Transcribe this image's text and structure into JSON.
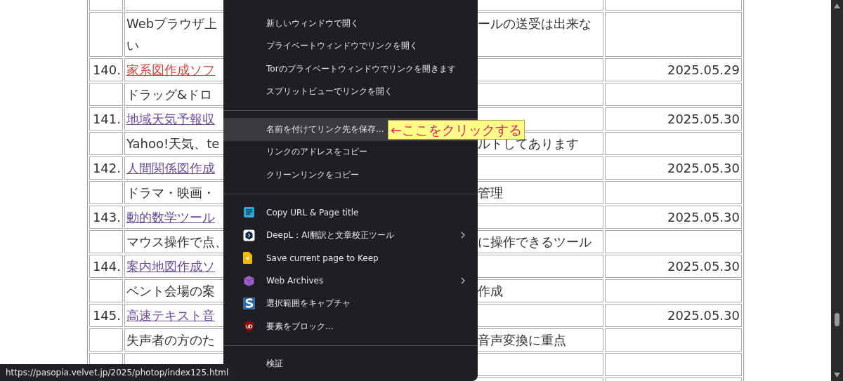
{
  "table": {
    "rows": [
      {
        "kind": "entry",
        "number": "",
        "title": "",
        "date": ""
      },
      {
        "kind": "desc",
        "left": "Webブラウザ上",
        "right": "ールの送受は出来な",
        "continuation": "い"
      },
      {
        "kind": "entry",
        "number": "140.",
        "title": "家系図作成ソフ",
        "visited": false,
        "date": "2025.05.29"
      },
      {
        "kind": "desc",
        "left": "ドラッグ&ドロ",
        "right": ""
      },
      {
        "kind": "entry",
        "number": "141.",
        "title": "地域天気予報収",
        "visited": true,
        "date": "2025.05.30"
      },
      {
        "kind": "desc",
        "left": "Yahoo!天気、te",
        "right": "ルトしてあります"
      },
      {
        "kind": "entry",
        "number": "142.",
        "title": "人間関係図作成",
        "visited": true,
        "date": "2025.05.30"
      },
      {
        "kind": "desc",
        "left": "ドラマ・映画・",
        "right": "管理"
      },
      {
        "kind": "entry",
        "number": "143.",
        "title": "動的数学ツール",
        "visited": true,
        "date": "2025.05.30"
      },
      {
        "kind": "desc",
        "left": "マウス操作で点、",
        "right": "に操作できるツール"
      },
      {
        "kind": "entry",
        "number": "144.",
        "title": "案内地図作成ソ",
        "visited": true,
        "date": "2025.05.30"
      },
      {
        "kind": "desc",
        "left": "ベント会場の案",
        "right": "作成"
      },
      {
        "kind": "entry",
        "number": "145.",
        "title": "高速テキスト音",
        "visited": true,
        "date": "2025.05.30"
      },
      {
        "kind": "desc",
        "left": "失声者の方のた",
        "right": "音声変換に重点"
      },
      {
        "kind": "entry",
        "number": "",
        "title": "",
        "date": ""
      },
      {
        "kind": "desc",
        "left": "",
        "right": ""
      }
    ]
  },
  "context_menu": {
    "groups": [
      [
        {
          "kind": "plain",
          "label": "新しいウィンドウで開く",
          "highlighted": false,
          "submenu": false
        },
        {
          "kind": "plain",
          "label": "プライベートウィンドウでリンクを開く",
          "highlighted": false,
          "submenu": false
        },
        {
          "kind": "plain",
          "label": "Torのプライベートウィンドウでリンクを開きます",
          "highlighted": false,
          "submenu": false
        },
        {
          "kind": "plain",
          "label": "スプリットビューでリンクを開く",
          "highlighted": false,
          "submenu": false
        }
      ],
      [
        {
          "kind": "plain",
          "label": "名前を付けてリンク先を保存...",
          "highlighted": true,
          "submenu": false
        },
        {
          "kind": "plain",
          "label": "リンクのアドレスをコピー",
          "highlighted": false,
          "submenu": false
        },
        {
          "kind": "plain",
          "label": "クリーンリンクをコピー",
          "highlighted": false,
          "submenu": false
        }
      ],
      [
        {
          "kind": "extension",
          "label": "Copy URL & Page title",
          "highlighted": false,
          "submenu": false
        },
        {
          "kind": "extension",
          "label": "DeepL：AI翻訳と文章校正ツール",
          "highlighted": false,
          "submenu": true
        },
        {
          "kind": "extension",
          "label": "Save current page to Keep",
          "highlighted": false,
          "submenu": false
        },
        {
          "kind": "extension",
          "label": "Web Archives",
          "highlighted": false,
          "submenu": true
        },
        {
          "kind": "extension",
          "label": "選択範囲をキャプチャ",
          "highlighted": false,
          "submenu": false
        },
        {
          "kind": "extension",
          "label": "要素をブロック...",
          "highlighted": false,
          "submenu": false
        }
      ],
      [
        {
          "kind": "plain",
          "label": "検証",
          "highlighted": false,
          "submenu": false
        }
      ]
    ]
  },
  "annotation": {
    "text": "←ここをクリックする"
  },
  "status_tooltip": {
    "url": "https://pasopia.velvet.jp/2025/photop/index125.html"
  }
}
